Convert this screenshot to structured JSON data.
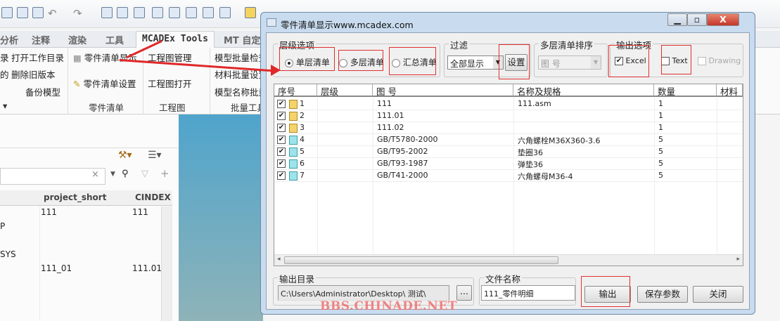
{
  "app": {
    "tabs": [
      "分析",
      "注释",
      "渲染",
      "工具",
      "MCADEx Tools",
      "MT 自定"
    ],
    "active_tab": "MCADEx Tools",
    "ribbon": {
      "col1": [
        "录",
        "的"
      ],
      "col2": [
        "打开工作目录",
        "删除旧版本",
        "备份模型"
      ],
      "bom": [
        "零件清单显示",
        "零件清单设置"
      ],
      "drawing": [
        "工程图管理",
        "工程图打开"
      ],
      "batch": [
        "模型批量检查",
        "材料批量设置",
        "模型名称批量"
      ],
      "groups": [
        "零件清单",
        "工程图",
        "批量工具"
      ]
    },
    "panel": {
      "columns": [
        "project_short",
        "CINDEX"
      ],
      "left_fragments": [
        "P",
        "SYS"
      ],
      "rows": [
        [
          "111",
          "111"
        ],
        [
          "111_01",
          "111.01"
        ]
      ],
      "clear_icon": "×"
    }
  },
  "dialog": {
    "title": "零件清单显示www.mcadex.com",
    "level_group": {
      "label": "层级选项",
      "options": [
        "单层清单",
        "多层清单",
        "汇总清单"
      ],
      "selected": "单层清单"
    },
    "filter_group": {
      "label": "过滤",
      "value": "全部显示",
      "settings_button": "设置"
    },
    "sort_group": {
      "label": "多层清单排序",
      "value": "图 号"
    },
    "output_group": {
      "label": "输出选项",
      "options": [
        {
          "label": "Excel",
          "checked": true,
          "enabled": true
        },
        {
          "label": "Text",
          "checked": false,
          "enabled": true
        },
        {
          "label": "Drawing",
          "checked": false,
          "enabled": false
        }
      ]
    },
    "table": {
      "columns": [
        "序号",
        "层级",
        "图 号",
        "名称及规格",
        "数量",
        "材料"
      ],
      "rows": [
        {
          "no": "1",
          "type": "assembly",
          "level": "",
          "drawing": "111",
          "name": "111.asm",
          "qty": "1",
          "material": "",
          "checked": true
        },
        {
          "no": "2",
          "type": "assembly",
          "level": "",
          "drawing": "111.01",
          "name": "",
          "qty": "1",
          "material": "",
          "checked": true
        },
        {
          "no": "3",
          "type": "assembly",
          "level": "",
          "drawing": "111.02",
          "name": "",
          "qty": "1",
          "material": "",
          "checked": true
        },
        {
          "no": "4",
          "type": "part",
          "level": "",
          "drawing": "GB/T5780-2000",
          "name": "六角螺栓M36X360-3.6",
          "qty": "5",
          "material": "",
          "checked": true
        },
        {
          "no": "5",
          "type": "part",
          "level": "",
          "drawing": "GB/T95-2002",
          "name": "垫圈36",
          "qty": "5",
          "material": "",
          "checked": true
        },
        {
          "no": "6",
          "type": "part",
          "level": "",
          "drawing": "GB/T93-1987",
          "name": "弹垫36",
          "qty": "5",
          "material": "",
          "checked": true
        },
        {
          "no": "7",
          "type": "part",
          "level": "",
          "drawing": "GB/T41-2000",
          "name": "六角螺母M36-4",
          "qty": "5",
          "material": "",
          "checked": true
        }
      ]
    },
    "output_dir": {
      "label": "输出目录",
      "value": "C:\\Users\\Administrator\\Desktop\\ 测试\\",
      "browse": "..."
    },
    "file_name": {
      "label": "文件名称",
      "value": "111_零件明细"
    },
    "buttons": {
      "export": "输出",
      "save": "保存参数",
      "close": "关闭"
    }
  },
  "watermark": "BBS.CHINADE.NET",
  "colors": {
    "annotation": "#e02828",
    "accent_blue": "#4fa4cc"
  }
}
